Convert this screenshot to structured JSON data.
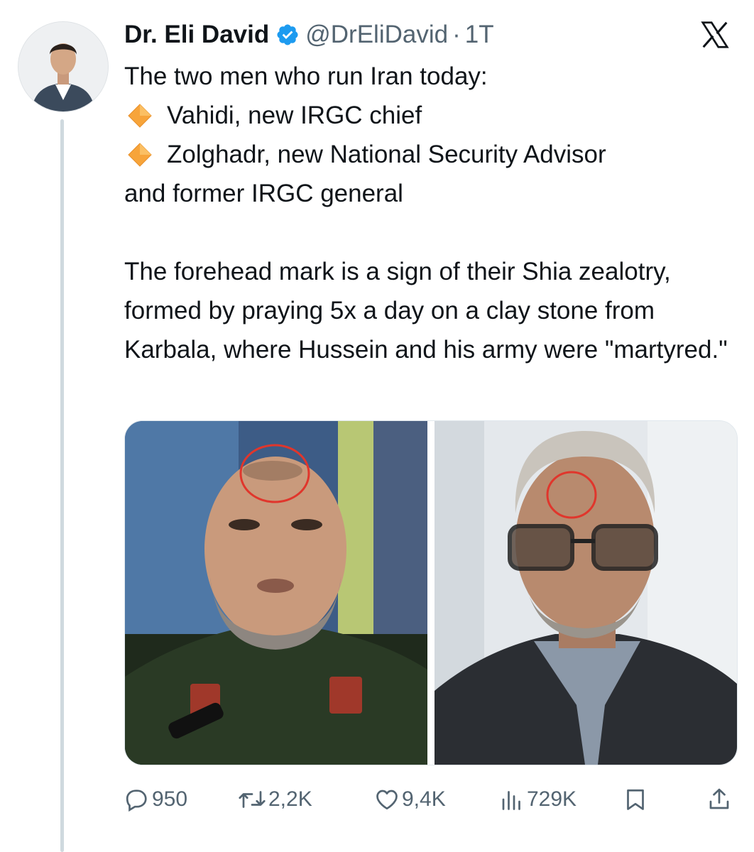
{
  "author": {
    "name": "Dr. Eli David",
    "handle": "@DrEliDavid",
    "separator": "·",
    "time": "1T",
    "verified": true,
    "verified_color": "#1d9bf0"
  },
  "brand": {
    "icon": "x-logo-icon"
  },
  "tweet": {
    "intro": "The two men who run Iran today:",
    "bullets": [
      {
        "icon": "orange-diamond-icon",
        "text": "Vahidi, new IRGC chief"
      },
      {
        "icon": "orange-diamond-icon",
        "text": "Zolghadr, new National Security Advisor"
      }
    ],
    "bullet_continuation": "and former IRGC general",
    "paragraph": "The forehead mark is a sign of their Shia zealotry, formed by praying 5x a day on a clay stone from Karbala, where Hussein and his army were \"martyred.\""
  },
  "media": [
    {
      "name": "vahidi-photo",
      "mark_color": "#e0362c"
    },
    {
      "name": "zolghadr-photo",
      "mark_color": "#e0362c"
    }
  ],
  "actions": {
    "replies": {
      "icon": "reply-icon",
      "count": "950"
    },
    "reposts": {
      "icon": "repost-icon",
      "count": "2,2K"
    },
    "likes": {
      "icon": "like-icon",
      "count": "9,4K"
    },
    "views": {
      "icon": "views-icon",
      "count": "729K"
    },
    "bookmark": {
      "icon": "bookmark-icon"
    },
    "share": {
      "icon": "share-icon"
    }
  },
  "colors": {
    "text": "#0f1419",
    "secondary": "#536471",
    "thread_line": "#cfd9de",
    "accent": "#1d9bf0"
  }
}
